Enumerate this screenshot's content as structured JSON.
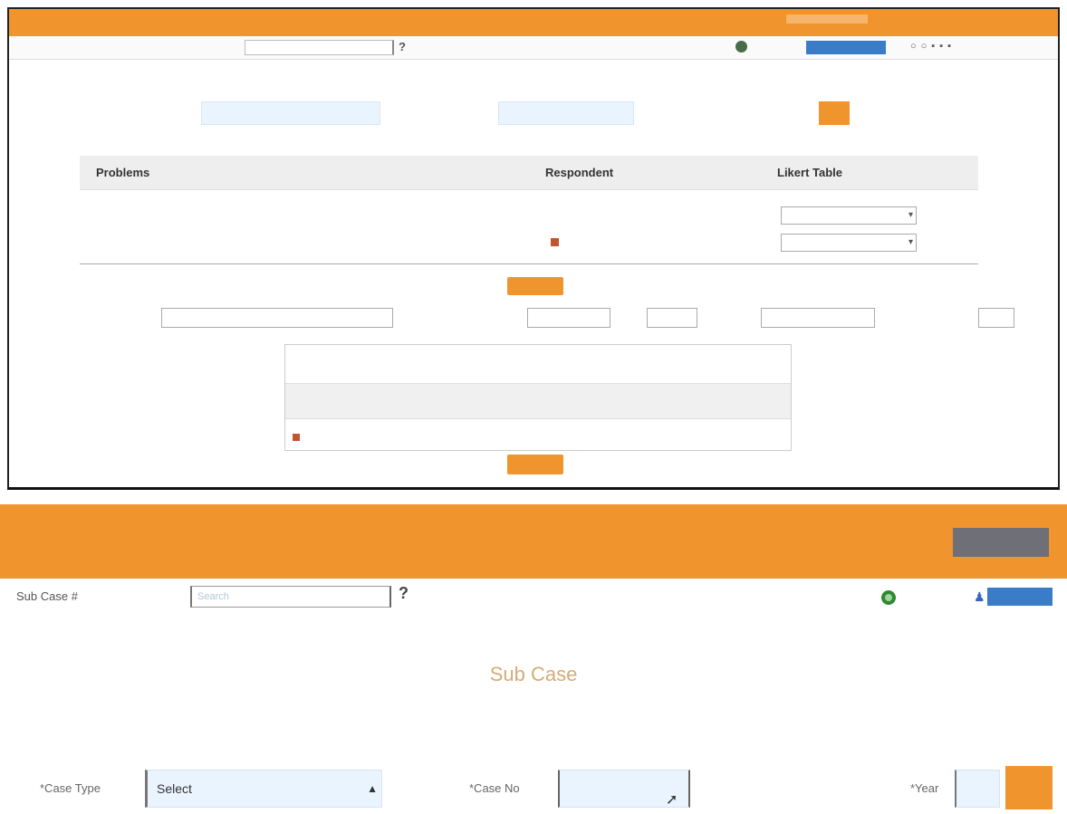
{
  "top_panel": {
    "title_bar": {
      "title": "",
      "right_text": ""
    },
    "search": {
      "label": "",
      "placeholder": "",
      "help": "?"
    },
    "heading": "",
    "filters": {
      "label1": "",
      "value1": "",
      "label2": "",
      "value2": "",
      "label3": "",
      "button": ""
    },
    "table": {
      "headers": [
        "Problems",
        "Respondent",
        "Likert Table"
      ],
      "row": {
        "problem": "",
        "response1": "",
        "response2": "",
        "select1": "",
        "select2": ""
      }
    },
    "submit1": "",
    "inputs": {
      "label1": "",
      "value1": "",
      "label2": "",
      "value2": "",
      "label3": "",
      "value3": "",
      "label4": "",
      "value4": "",
      "label5": "",
      "value5": ""
    },
    "dropdown": {
      "option1": "",
      "option2": "",
      "option3": ""
    },
    "submit2": ""
  },
  "bottom_panel": {
    "banner": {
      "subtitle": "",
      "message": "",
      "button": ""
    },
    "search": {
      "label": "Sub Case #",
      "placeholder": "Search",
      "help": "?"
    },
    "title": "Sub Case",
    "success_line1": "",
    "success_line2": "",
    "form": {
      "case_type_label": "*Case Type",
      "case_type_value": "Select",
      "case_no_label": "*Case No",
      "year_label": "*Year",
      "go_label": ""
    }
  },
  "colors": {
    "accent_orange": "#f0942e",
    "success_green": "#3fa43f",
    "title_tan": "#d5ab77",
    "blue": "#3a7cc8"
  },
  "icons": [
    "help-icon",
    "refresh-icon",
    "user-icon",
    "gear-icon",
    "chevron-down-icon",
    "mouse-cursor-icon"
  ]
}
